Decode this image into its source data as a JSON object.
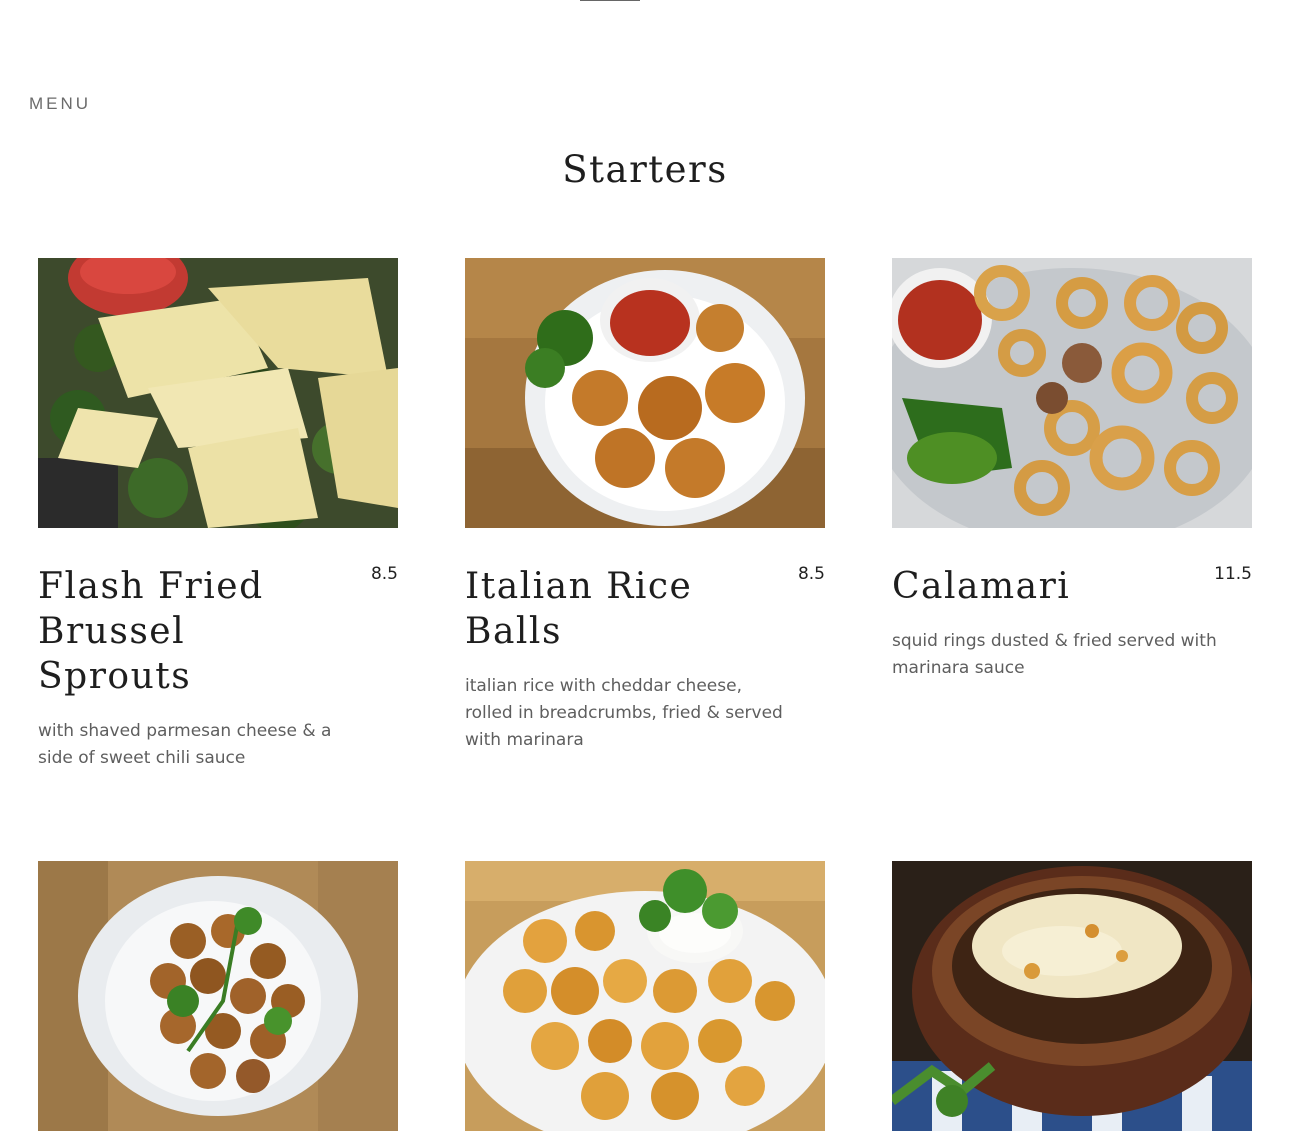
{
  "header": {
    "menu_label": "MENU"
  },
  "section": {
    "title": "Starters"
  },
  "items": [
    {
      "name": "Flash Fried Brussel Sprouts",
      "price": "8.5",
      "description": "with shaved parmesan cheese & a side of sweet chili sauce",
      "image": "brussel-sprouts-photo"
    },
    {
      "name": "Italian Rice Balls",
      "price": "8.5",
      "description": "italian rice with cheddar cheese, rolled in breadcrumbs, fried & served with marinara",
      "image": "rice-balls-photo"
    },
    {
      "name": "Calamari",
      "price": "11.5",
      "description": "squid rings dusted & fried served with marinara sauce",
      "image": "calamari-photo"
    },
    {
      "image": "potato-bites-photo"
    },
    {
      "image": "fried-cheese-bites-photo"
    },
    {
      "image": "french-onion-soup-photo"
    }
  ],
  "colors": {
    "title": "#1e1e1e",
    "description": "#5e5e5e",
    "menu_label": "#6b6b6b"
  }
}
